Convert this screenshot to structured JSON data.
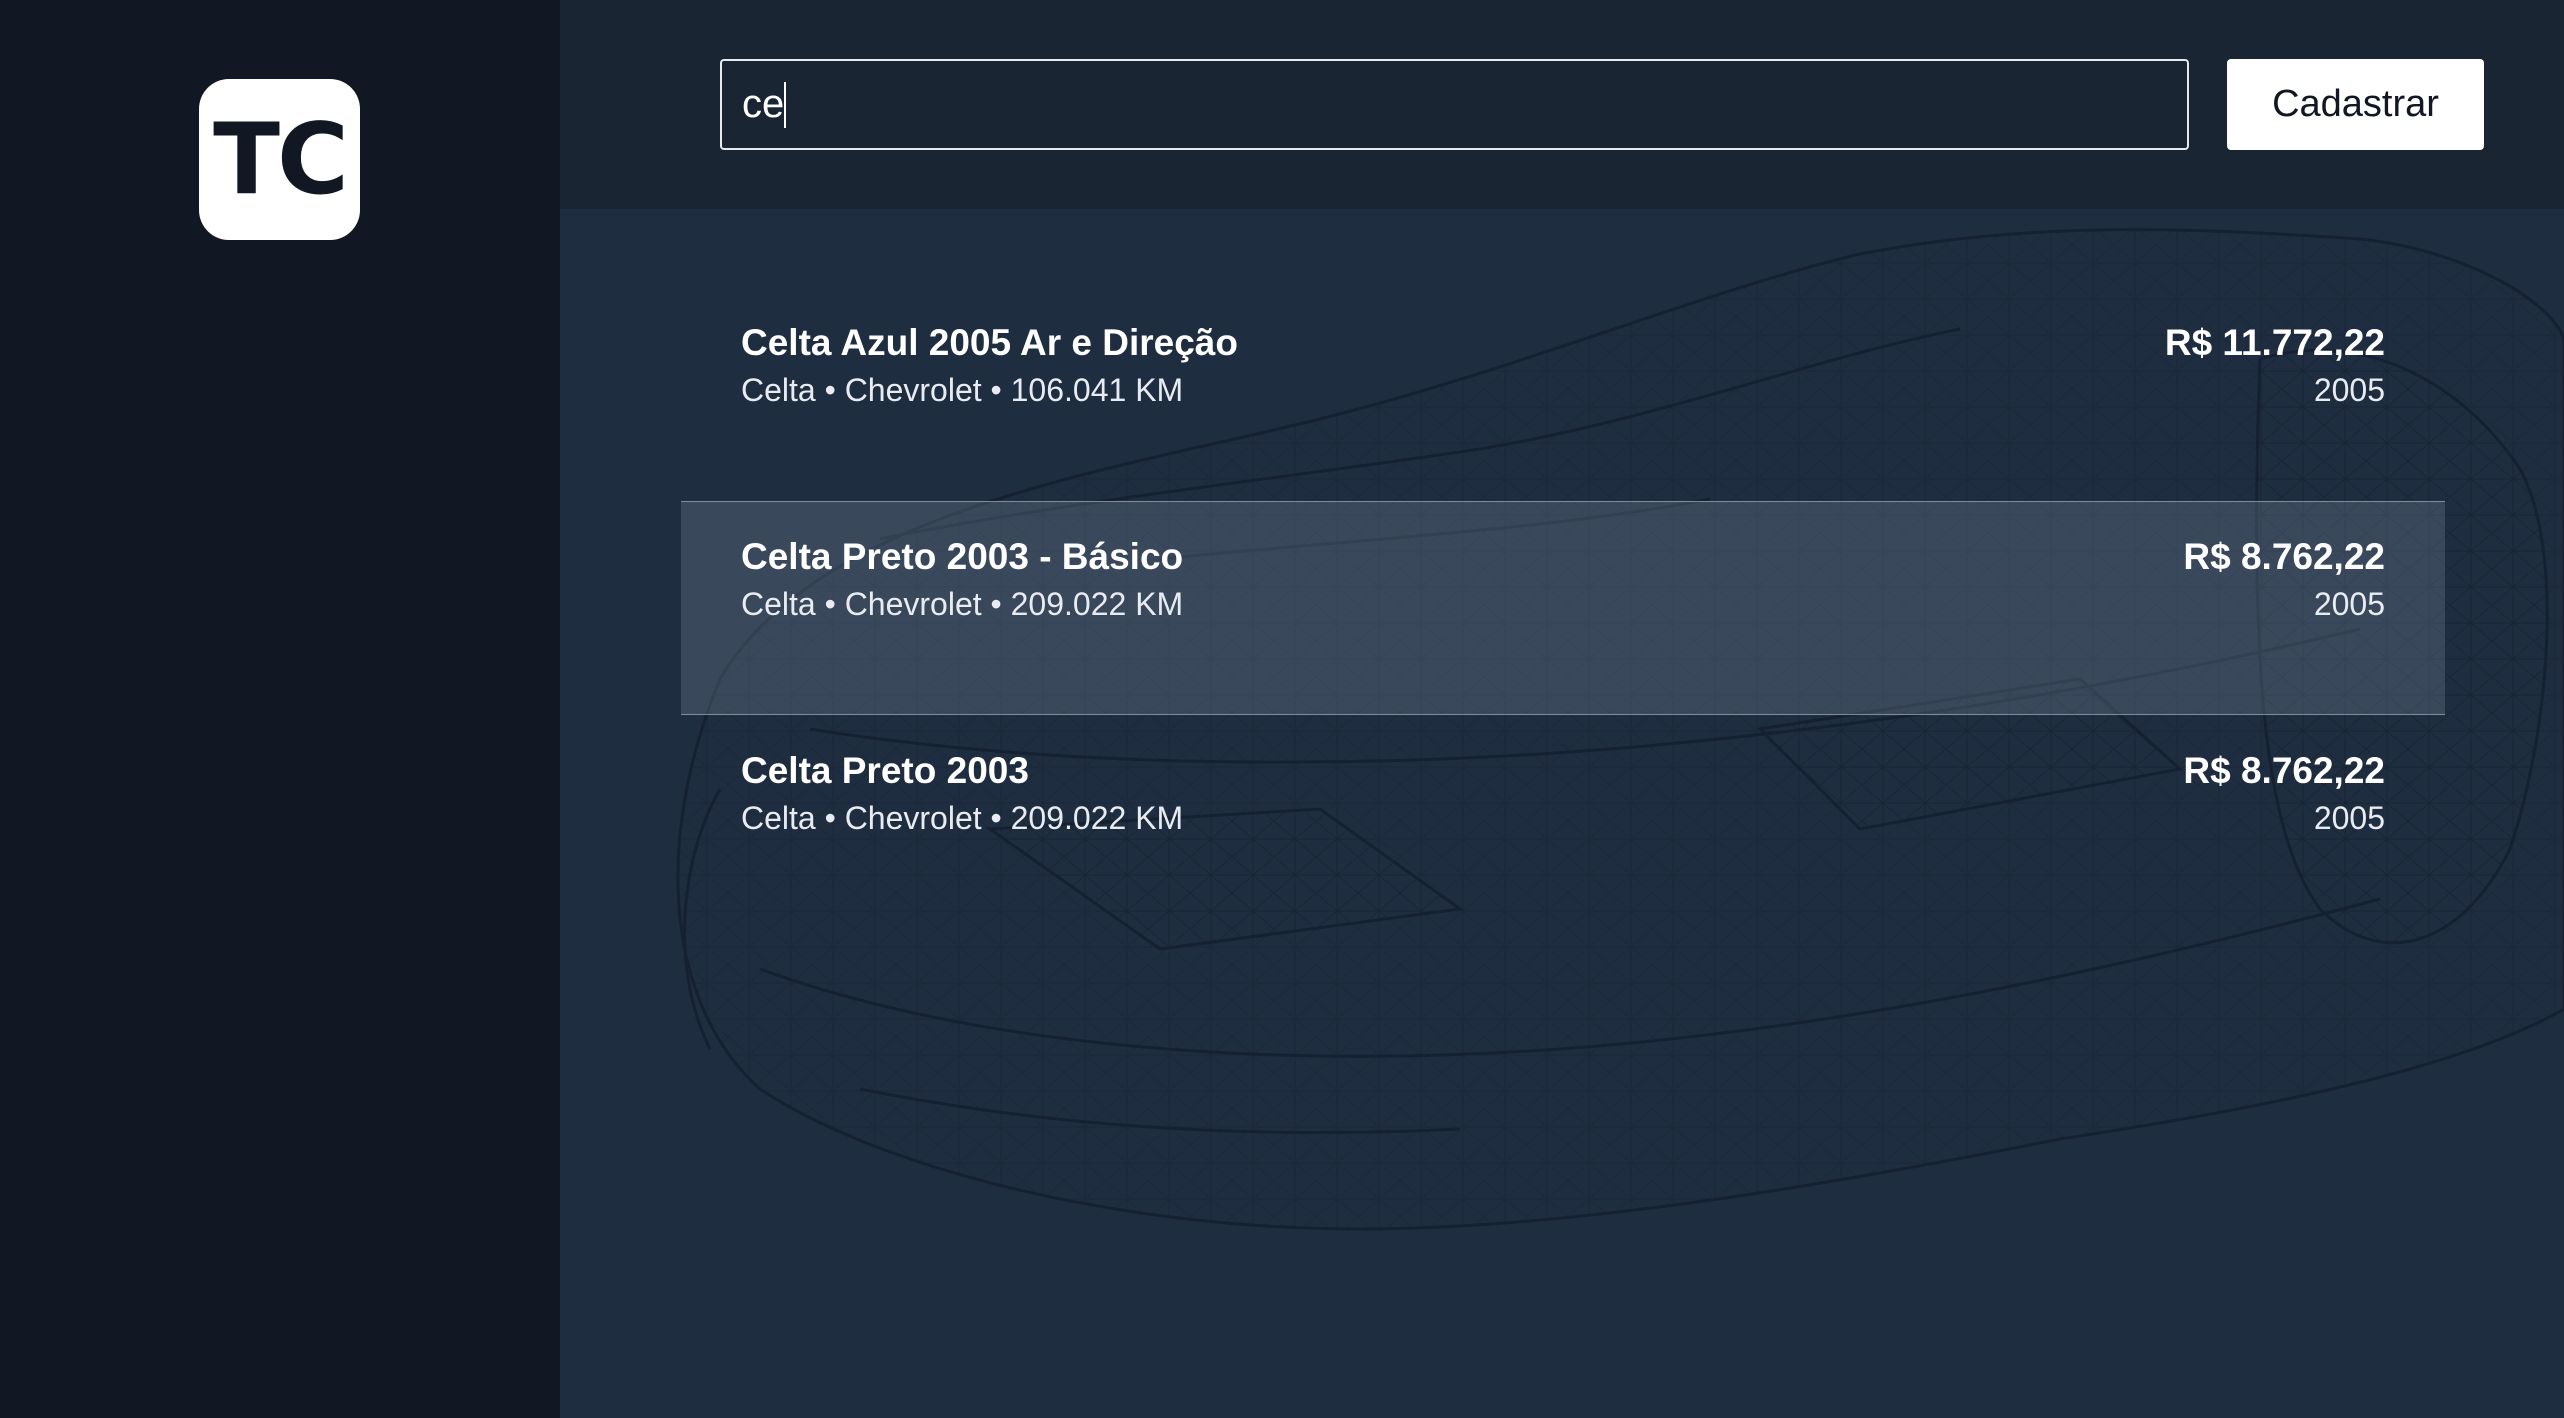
{
  "app": {
    "logo_text": "TC"
  },
  "header": {
    "search_value": "ce",
    "register_label": "Cadastrar"
  },
  "listings": [
    {
      "title": "Celta Azul 2005 Ar e Direção",
      "subtitle": "Celta • Chevrolet • 106.041 KM",
      "price": "R$ 11.772,22",
      "year": "2005"
    },
    {
      "title": "Celta Preto 2003 - Básico",
      "subtitle": "Celta • Chevrolet • 209.022 KM",
      "price": "R$ 8.762,22",
      "year": "2005"
    },
    {
      "title": "Celta Preto 2003",
      "subtitle": "Celta • Chevrolet • 209.022 KM",
      "price": "R$ 8.762,22",
      "year": "2005"
    }
  ],
  "colors": {
    "sidebar_bg": "#111824",
    "topbar_bg": "#1a2534",
    "content_bg": "#1f2d40",
    "highlight_row": "#4a5669"
  }
}
